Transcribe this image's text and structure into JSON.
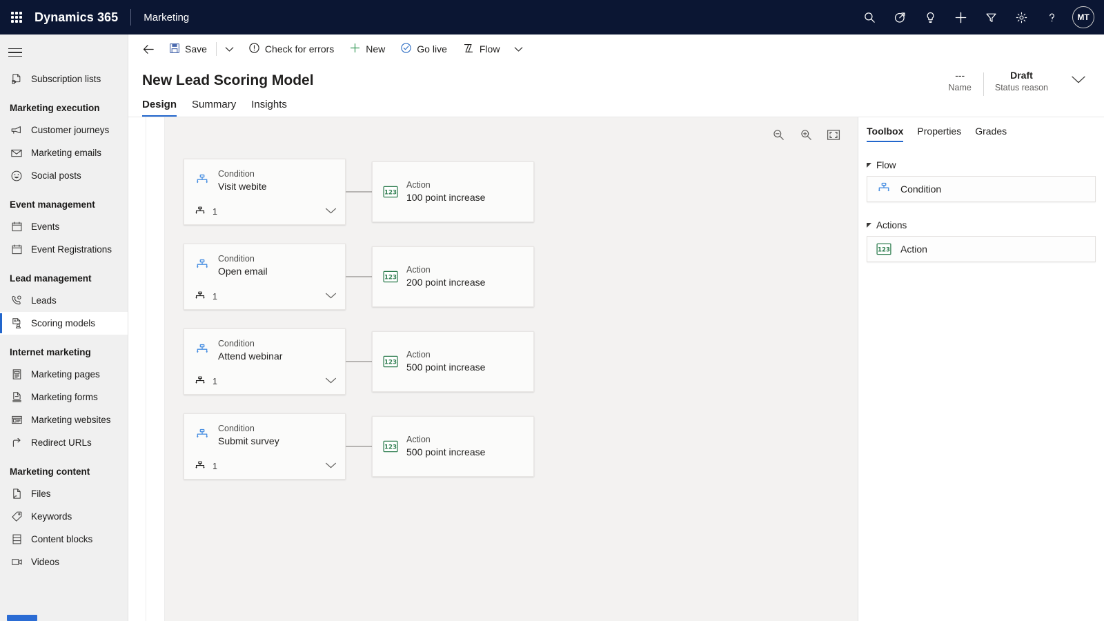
{
  "header": {
    "waffle_icon": "app-launcher-icon",
    "brand": "Dynamics 365",
    "app_area": "Marketing",
    "accent_color": "#2266cc",
    "header_bg": "#0b1633",
    "icons": [
      {
        "name": "search-icon",
        "label": "Search"
      },
      {
        "name": "assistant-icon",
        "label": "Relationship assistant"
      },
      {
        "name": "lightbulb-icon",
        "label": "Insights"
      },
      {
        "name": "add-icon",
        "label": "Quick create"
      },
      {
        "name": "filter-icon",
        "label": "Filter"
      },
      {
        "name": "gear-icon",
        "label": "Settings"
      },
      {
        "name": "help-icon",
        "label": "Help"
      }
    ],
    "avatar_initials": "MT"
  },
  "sidebar": {
    "hamburger_label": "Site map",
    "items": [
      {
        "type": "item",
        "label": "Subscription lists",
        "icon": "subscription-list-icon",
        "selected": false
      },
      {
        "type": "group",
        "label": "Marketing execution"
      },
      {
        "type": "item",
        "label": "Customer journeys",
        "icon": "megaphone-icon",
        "selected": false
      },
      {
        "type": "item",
        "label": "Marketing emails",
        "icon": "envelope-icon",
        "selected": false
      },
      {
        "type": "item",
        "label": "Social posts",
        "icon": "smiley-icon",
        "selected": false
      },
      {
        "type": "group",
        "label": "Event management"
      },
      {
        "type": "item",
        "label": "Events",
        "icon": "calendar-icon",
        "selected": false
      },
      {
        "type": "item",
        "label": "Event Registrations",
        "icon": "calendar-icon",
        "selected": false
      },
      {
        "type": "group",
        "label": "Lead management"
      },
      {
        "type": "item",
        "label": "Leads",
        "icon": "lead-phone-icon",
        "selected": false
      },
      {
        "type": "item",
        "label": "Scoring models",
        "icon": "scoring-model-icon",
        "selected": true
      },
      {
        "type": "group",
        "label": "Internet marketing"
      },
      {
        "type": "item",
        "label": "Marketing pages",
        "icon": "page-icon",
        "selected": false
      },
      {
        "type": "item",
        "label": "Marketing forms",
        "icon": "form-icon",
        "selected": false
      },
      {
        "type": "item",
        "label": "Marketing websites",
        "icon": "website-icon",
        "selected": false
      },
      {
        "type": "item",
        "label": "Redirect URLs",
        "icon": "redirect-arrow-icon",
        "selected": false
      },
      {
        "type": "group",
        "label": "Marketing content"
      },
      {
        "type": "item",
        "label": "Files",
        "icon": "file-icon",
        "selected": false
      },
      {
        "type": "item",
        "label": "Keywords",
        "icon": "tag-icon",
        "selected": false
      },
      {
        "type": "item",
        "label": "Content blocks",
        "icon": "content-block-icon",
        "selected": false
      },
      {
        "type": "item",
        "label": "Videos",
        "icon": "video-camera-icon",
        "selected": false
      }
    ]
  },
  "command_bar": {
    "back_icon": "back-arrow-icon",
    "buttons": [
      {
        "label": "Save",
        "icon": "save-icon"
      },
      {
        "label": "Check for errors",
        "icon": "error-circle-icon"
      },
      {
        "label": "New",
        "icon": "plus-icon"
      },
      {
        "label": "Go live",
        "icon": "check-circle-icon"
      },
      {
        "label": "Flow",
        "icon": "flow-icon"
      }
    ],
    "overflow_caret": "chevron-down-icon"
  },
  "record": {
    "title": "New Lead Scoring Model",
    "fields": [
      {
        "value": "---",
        "label": "Name",
        "bold": false
      },
      {
        "value": "Draft",
        "label": "Status reason",
        "bold": true
      }
    ],
    "expand_icon": "chevron-down-icon"
  },
  "tabs": [
    {
      "label": "Design",
      "active": true
    },
    {
      "label": "Summary",
      "active": false
    },
    {
      "label": "Insights",
      "active": false
    }
  ],
  "canvas": {
    "tools": [
      {
        "name": "zoom-out-icon",
        "label": "Zoom out"
      },
      {
        "name": "zoom-in-icon",
        "label": "Zoom in"
      },
      {
        "name": "fit-to-screen-icon",
        "label": "Fit to screen"
      }
    ],
    "rows": [
      {
        "condition": {
          "type": "Condition",
          "name": "Visit webite",
          "branch_count": "1",
          "icon": "condition-branch-icon",
          "chevron": "chevron-down-icon",
          "branch_icon": "branch-count-icon"
        },
        "action": {
          "type": "Action",
          "name": "100 point increase",
          "icon": "numeric-123-icon"
        }
      },
      {
        "condition": {
          "type": "Condition",
          "name": "Open email",
          "branch_count": "1",
          "icon": "condition-branch-icon",
          "chevron": "chevron-down-icon",
          "branch_icon": "branch-count-icon"
        },
        "action": {
          "type": "Action",
          "name": "200 point increase",
          "icon": "numeric-123-icon"
        }
      },
      {
        "condition": {
          "type": "Condition",
          "name": "Attend webinar",
          "branch_count": "1",
          "icon": "condition-branch-icon",
          "chevron": "chevron-down-icon",
          "branch_icon": "branch-count-icon"
        },
        "action": {
          "type": "Action",
          "name": "500 point increase",
          "icon": "numeric-123-icon"
        }
      },
      {
        "condition": {
          "type": "Condition",
          "name": "Submit survey",
          "branch_count": "1",
          "icon": "condition-branch-icon",
          "chevron": "chevron-down-icon",
          "branch_icon": "branch-count-icon"
        },
        "action": {
          "type": "Action",
          "name": "500 point increase",
          "icon": "numeric-123-icon"
        }
      }
    ]
  },
  "right_panel": {
    "tabs": [
      {
        "label": "Toolbox",
        "active": true
      },
      {
        "label": "Properties",
        "active": false
      },
      {
        "label": "Grades",
        "active": false
      }
    ],
    "sections": [
      {
        "label": "Flow",
        "items": [
          {
            "label": "Condition",
            "icon": "condition-branch-icon"
          }
        ]
      },
      {
        "label": "Actions",
        "items": [
          {
            "label": "Action",
            "icon": "numeric-123-icon"
          }
        ]
      }
    ]
  }
}
